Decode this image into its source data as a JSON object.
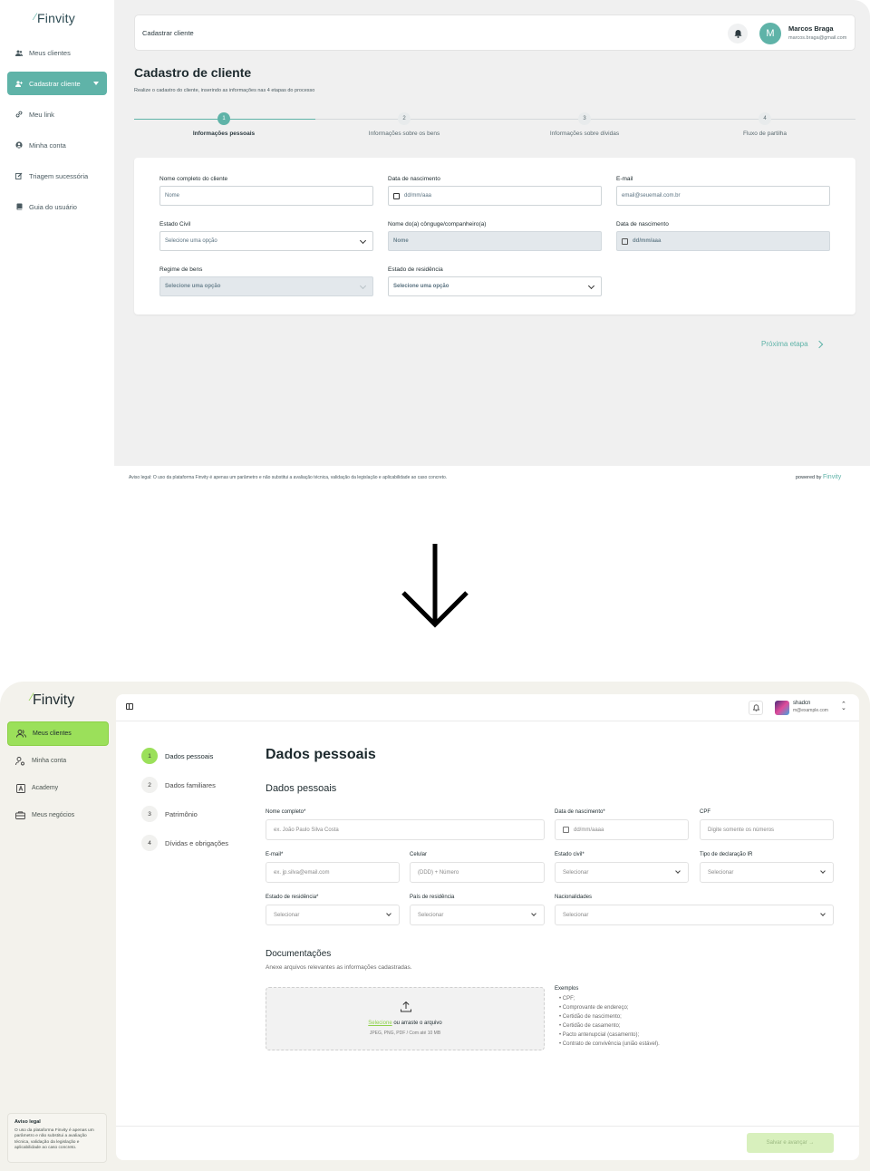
{
  "old": {
    "logo": "Finvity",
    "nav": [
      {
        "label": "Meus clientes",
        "icon": "users-icon"
      },
      {
        "label": "Cadastrar cliente",
        "icon": "user-plus-icon"
      },
      {
        "label": "Meu link",
        "icon": "link-icon"
      },
      {
        "label": "Minha conta",
        "icon": "user-circle-icon"
      },
      {
        "label": "Triagem sucessória",
        "icon": "edit-icon"
      },
      {
        "label": "Guia do usuário",
        "icon": "book-icon"
      }
    ],
    "breadcrumb": "Cadastrar cliente",
    "user": {
      "name": "Marcos Braga",
      "email": "marcos.braga@gmail.com",
      "initial": "M"
    },
    "title": "Cadastro de cliente",
    "subtitle": "Realize o cadastro do cliente, inserindo as informações nas 4 etapas do processo",
    "steps": [
      {
        "num": "1",
        "label": "Informações pessoais"
      },
      {
        "num": "2",
        "label": "Informações sobre os bens"
      },
      {
        "num": "3",
        "label": "Informações sobre dívidas"
      },
      {
        "num": "4",
        "label": "Fluxo de partilha"
      }
    ],
    "form": {
      "full_name_label": "Nome completo do cliente",
      "full_name_ph": "Nome",
      "birth_label": "Data de nascimento",
      "birth_ph": "dd/mm/aaa",
      "email_label": "E-mail",
      "email_ph": "email@seuemail.com.br",
      "civil_label": "Estado Civil",
      "civil_ph": "Selecione uma opção",
      "spouse_label": "Nome do(a) cônguge/companheiro(a)",
      "spouse_ph": "Nome",
      "spouse_birth_label": "Data de nascimento",
      "spouse_birth_ph": "dd/mm/aaa",
      "regime_label": "Regime de bens",
      "regime_ph": "Selecione uma opção",
      "state_label": "Estado de residência",
      "state_ph": "Selecione uma opção"
    },
    "next_label": "Próxima etapa",
    "footer_legal": "Aviso legal: O uso da plataforma Finvity é apenas um parâmetro e não substitui a avaliação técnica, validação da legislação e aplicabilidade ao caso concreto.",
    "powered_by": "powered by",
    "powered_brand": "Finvity"
  },
  "new": {
    "logo": "Finvity",
    "nav": [
      {
        "label": "Meus clientes",
        "icon": "users-icon"
      },
      {
        "label": "Minha conta",
        "icon": "user-settings-icon"
      },
      {
        "label": "Academy",
        "icon": "academy-icon"
      },
      {
        "label": "Meus negócios",
        "icon": "briefcase-icon"
      }
    ],
    "legal_title": "Aviso legal",
    "legal_text": "O uso da plataforma Finvity é apenas um parâmetro e não substitui a avaliação técnica, validação da legislação e aplicabilidade ao caso concreto.",
    "user": {
      "name": "shadcn",
      "email": "m@example.com"
    },
    "steps": [
      {
        "num": "1",
        "label": "Dados pessoais"
      },
      {
        "num": "2",
        "label": "Dados familiares"
      },
      {
        "num": "3",
        "label": "Patrimônio"
      },
      {
        "num": "4",
        "label": "Dívidas e obrigações"
      }
    ],
    "title": "Dados pessoais",
    "section": "Dados pessoais",
    "form": {
      "name_label": "Nome completo*",
      "name_ph": "ex. João Paulo Silva Costa",
      "birth_label": "Data de nascimento*",
      "birth_ph": "dd/mm/aaaa",
      "cpf_label": "CPF",
      "cpf_ph": "Digite somente os números",
      "email_label": "E-mail*",
      "email_ph": "ex. jp.silva@email.com",
      "phone_label": "Celular",
      "phone_ph": "(DDD) + Número",
      "civil_label": "Estado civil*",
      "civil_ph": "Selecionar",
      "ir_label": "Tipo de declaração IR",
      "ir_ph": "Selecionar",
      "state_label": "Estado de residência*",
      "state_ph": "Selecionar",
      "country_label": "País de residência",
      "country_ph": "Selecionar",
      "nat_label": "Nacionalidades",
      "nat_ph": "Selecionar"
    },
    "docs_title": "Documentações",
    "docs_sub": "Anexe arquivos relevantes as informações cadastradas.",
    "upload_link": "Selecione",
    "upload_text": " ou arraste o arquivo",
    "upload_formats": "JPEG, PNG, PDF / Com até 10 MB",
    "examples_title": "Exemplos",
    "examples": [
      "• CPF;",
      "• Comprovante de endereço;",
      "• Certidão de nascimento;",
      "• Certidão de casamento;",
      "• Pacto antenupcial (casamento);",
      "• Contrato de convivência (união estável)."
    ],
    "save_label": "Salvar e avançar →"
  }
}
